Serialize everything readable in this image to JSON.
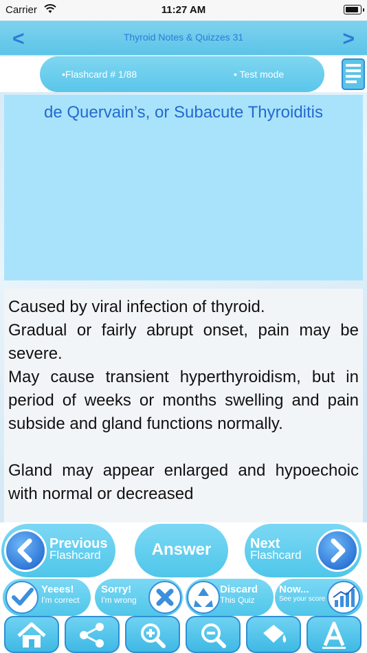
{
  "status_bar": {
    "carrier": "Carrier",
    "time": "11:27 AM"
  },
  "nav": {
    "back": "<",
    "forward": ">",
    "title": "Thyroid Notes & Quizzes 31"
  },
  "info_bar": {
    "counter": "•Flashcard #  1/88",
    "mode": "• Test mode"
  },
  "question": {
    "title": "de Quervain’s, or Subacute Thyroiditis"
  },
  "answer": {
    "paragraphs": [
      "Caused by viral infection of thyroid.",
      "Gradual or fairly abrupt onset, pain may be severe.",
      "May cause transient hyperthyroidism, but in period of weeks or months swelling and pain subside and gland functions normally.",
      "",
      "Gland may appear enlarged and hypoechoic with normal or decreased"
    ]
  },
  "controls": {
    "previous": {
      "title": "Previous",
      "sub": "Flashcard"
    },
    "answer_label": "Answer",
    "next": {
      "title": "Next",
      "sub": "Flashcard"
    },
    "yes": {
      "title": "Yeees!",
      "sub": "I'm correct"
    },
    "sorry": {
      "title": "Sorry!",
      "sub": "I'm wrong"
    },
    "discard": {
      "title": "Discard",
      "sub": "This Quiz"
    },
    "now": {
      "title": "Now...",
      "sub": "See your score"
    }
  },
  "icons": {
    "home": "home-icon",
    "share": "share-icon",
    "zoom_in": "zoom-in-icon",
    "zoom_out": "zoom-out-icon",
    "bucket": "paint-bucket-icon",
    "font": "font-icon"
  },
  "colors": {
    "accent": "#5cc4e8",
    "link": "#2d7bd8",
    "question_bg": "#a8e3fb"
  }
}
